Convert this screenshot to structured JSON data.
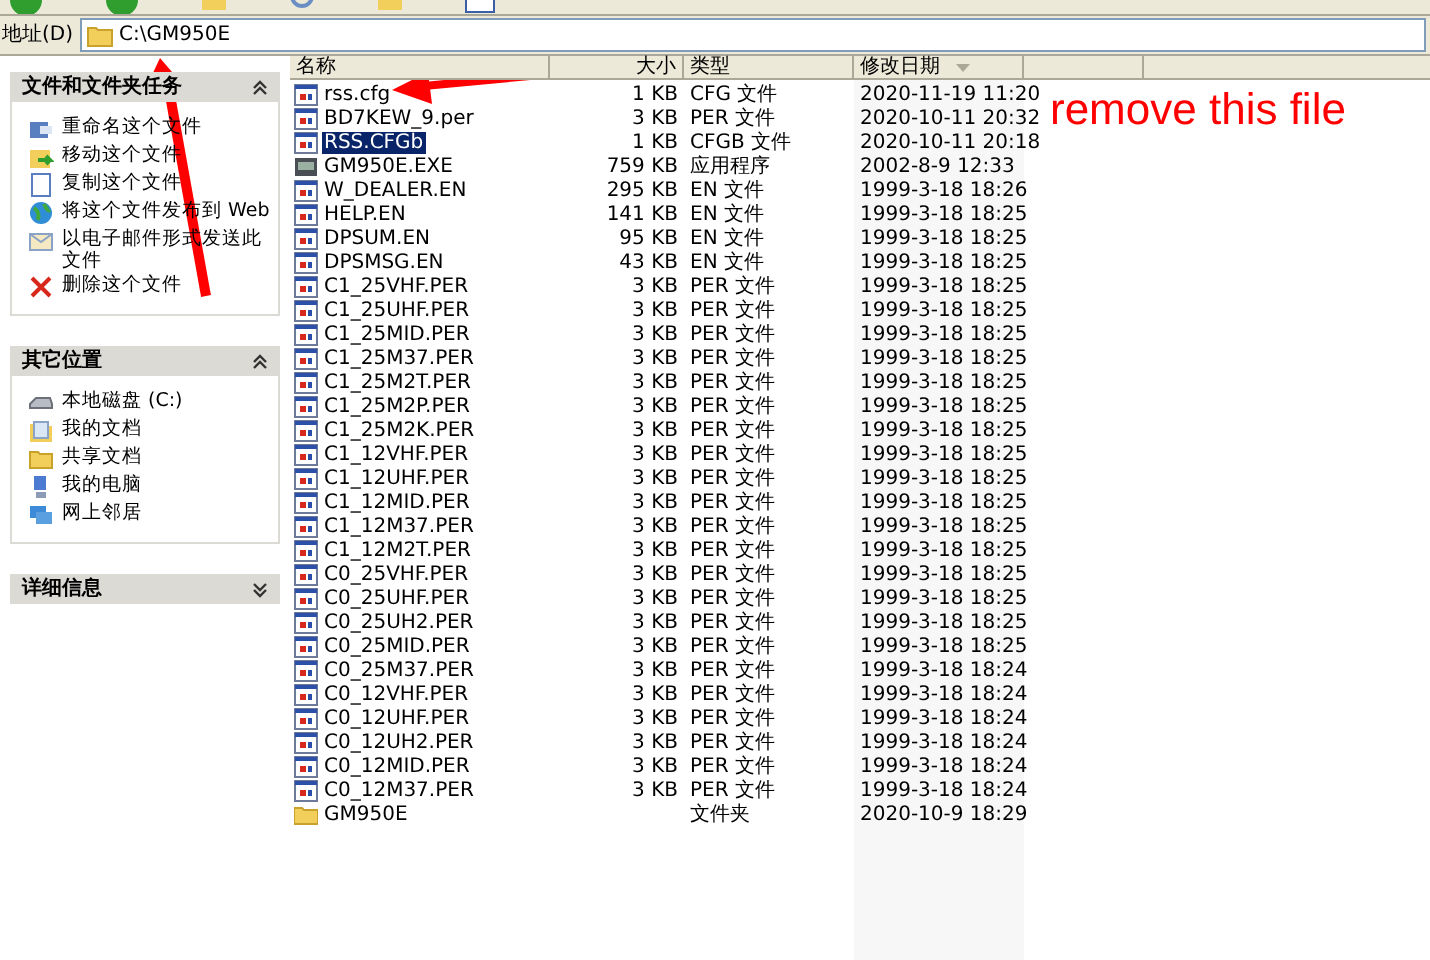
{
  "address_bar": {
    "label": "地址(D)",
    "value": "C:\\GM950E"
  },
  "sidebar": [
    {
      "title": "文件和文件夹任务",
      "expanded": true,
      "items": [
        {
          "label": "重命名这个文件"
        },
        {
          "label": "移动这个文件"
        },
        {
          "label": "复制这个文件"
        },
        {
          "label": "将这个文件发布到 Web"
        },
        {
          "label": "以电子邮件形式发送此文件"
        },
        {
          "label": "删除这个文件"
        }
      ]
    },
    {
      "title": "其它位置",
      "expanded": true,
      "items": [
        {
          "label": "本地磁盘 (C:)"
        },
        {
          "label": "我的文档"
        },
        {
          "label": "共享文档"
        },
        {
          "label": "我的电脑"
        },
        {
          "label": "网上邻居"
        }
      ]
    },
    {
      "title": "详细信息",
      "expanded": false
    }
  ],
  "columns": [
    "名称",
    "大小",
    "类型",
    "修改日期"
  ],
  "rows": [
    {
      "name": "rss.cfg",
      "size": "1 KB",
      "type": "CFG 文件",
      "date": "2020-11-19 11:20",
      "kind": "file",
      "selected": false
    },
    {
      "name": "BD7KEW_9.per",
      "size": "3 KB",
      "type": "PER 文件",
      "date": "2020-10-11 20:32",
      "kind": "file",
      "selected": false
    },
    {
      "name": "RSS.CFGb",
      "size": "1 KB",
      "type": "CFGB 文件",
      "date": "2020-10-11 20:18",
      "kind": "file",
      "selected": true
    },
    {
      "name": "GM950E.EXE",
      "size": "759 KB",
      "type": "应用程序",
      "date": "2002-8-9 12:33",
      "kind": "exe",
      "selected": false
    },
    {
      "name": "W_DEALER.EN",
      "size": "295 KB",
      "type": "EN 文件",
      "date": "1999-3-18 18:26",
      "kind": "file",
      "selected": false
    },
    {
      "name": "HELP.EN",
      "size": "141 KB",
      "type": "EN 文件",
      "date": "1999-3-18 18:25",
      "kind": "file",
      "selected": false
    },
    {
      "name": "DPSUM.EN",
      "size": "95 KB",
      "type": "EN 文件",
      "date": "1999-3-18 18:25",
      "kind": "file",
      "selected": false
    },
    {
      "name": "DPSMSG.EN",
      "size": "43 KB",
      "type": "EN 文件",
      "date": "1999-3-18 18:25",
      "kind": "file",
      "selected": false
    },
    {
      "name": "C1_25VHF.PER",
      "size": "3 KB",
      "type": "PER 文件",
      "date": "1999-3-18 18:25",
      "kind": "file",
      "selected": false
    },
    {
      "name": "C1_25UHF.PER",
      "size": "3 KB",
      "type": "PER 文件",
      "date": "1999-3-18 18:25",
      "kind": "file",
      "selected": false
    },
    {
      "name": "C1_25MID.PER",
      "size": "3 KB",
      "type": "PER 文件",
      "date": "1999-3-18 18:25",
      "kind": "file",
      "selected": false
    },
    {
      "name": "C1_25M37.PER",
      "size": "3 KB",
      "type": "PER 文件",
      "date": "1999-3-18 18:25",
      "kind": "file",
      "selected": false
    },
    {
      "name": "C1_25M2T.PER",
      "size": "3 KB",
      "type": "PER 文件",
      "date": "1999-3-18 18:25",
      "kind": "file",
      "selected": false
    },
    {
      "name": "C1_25M2P.PER",
      "size": "3 KB",
      "type": "PER 文件",
      "date": "1999-3-18 18:25",
      "kind": "file",
      "selected": false
    },
    {
      "name": "C1_25M2K.PER",
      "size": "3 KB",
      "type": "PER 文件",
      "date": "1999-3-18 18:25",
      "kind": "file",
      "selected": false
    },
    {
      "name": "C1_12VHF.PER",
      "size": "3 KB",
      "type": "PER 文件",
      "date": "1999-3-18 18:25",
      "kind": "file",
      "selected": false
    },
    {
      "name": "C1_12UHF.PER",
      "size": "3 KB",
      "type": "PER 文件",
      "date": "1999-3-18 18:25",
      "kind": "file",
      "selected": false
    },
    {
      "name": "C1_12MID.PER",
      "size": "3 KB",
      "type": "PER 文件",
      "date": "1999-3-18 18:25",
      "kind": "file",
      "selected": false
    },
    {
      "name": "C1_12M37.PER",
      "size": "3 KB",
      "type": "PER 文件",
      "date": "1999-3-18 18:25",
      "kind": "file",
      "selected": false
    },
    {
      "name": "C1_12M2T.PER",
      "size": "3 KB",
      "type": "PER 文件",
      "date": "1999-3-18 18:25",
      "kind": "file",
      "selected": false
    },
    {
      "name": "C0_25VHF.PER",
      "size": "3 KB",
      "type": "PER 文件",
      "date": "1999-3-18 18:25",
      "kind": "file",
      "selected": false
    },
    {
      "name": "C0_25UHF.PER",
      "size": "3 KB",
      "type": "PER 文件",
      "date": "1999-3-18 18:25",
      "kind": "file",
      "selected": false
    },
    {
      "name": "C0_25UH2.PER",
      "size": "3 KB",
      "type": "PER 文件",
      "date": "1999-3-18 18:25",
      "kind": "file",
      "selected": false
    },
    {
      "name": "C0_25MID.PER",
      "size": "3 KB",
      "type": "PER 文件",
      "date": "1999-3-18 18:25",
      "kind": "file",
      "selected": false
    },
    {
      "name": "C0_25M37.PER",
      "size": "3 KB",
      "type": "PER 文件",
      "date": "1999-3-18 18:24",
      "kind": "file",
      "selected": false
    },
    {
      "name": "C0_12VHF.PER",
      "size": "3 KB",
      "type": "PER 文件",
      "date": "1999-3-18 18:24",
      "kind": "file",
      "selected": false
    },
    {
      "name": "C0_12UHF.PER",
      "size": "3 KB",
      "type": "PER 文件",
      "date": "1999-3-18 18:24",
      "kind": "file",
      "selected": false
    },
    {
      "name": "C0_12UH2.PER",
      "size": "3 KB",
      "type": "PER 文件",
      "date": "1999-3-18 18:24",
      "kind": "file",
      "selected": false
    },
    {
      "name": "C0_12MID.PER",
      "size": "3 KB",
      "type": "PER 文件",
      "date": "1999-3-18 18:24",
      "kind": "file",
      "selected": false
    },
    {
      "name": "C0_12M37.PER",
      "size": "3 KB",
      "type": "PER 文件",
      "date": "1999-3-18 18:24",
      "kind": "file",
      "selected": false
    },
    {
      "name": "GM950E",
      "type": "文件夹",
      "date": "2020-10-9 18:29",
      "kind": "folder",
      "selected": false
    }
  ],
  "annotation": {
    "text": "remove this file"
  }
}
